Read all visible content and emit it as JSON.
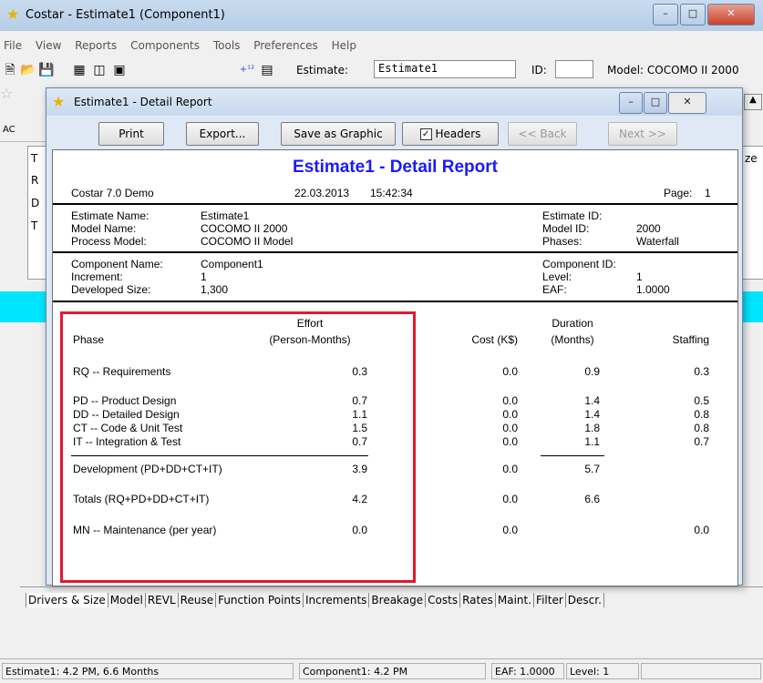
{
  "app": {
    "title": "Costar - Estimate1 (Component1)",
    "menu": [
      "File",
      "View",
      "Reports",
      "Components",
      "Tools",
      "Preferences",
      "Help"
    ],
    "estimate_label": "Estimate:",
    "estimate_value": "Estimate1",
    "id_label": "ID:",
    "id_value": "",
    "model_label": "Model: COCOMO II 2000",
    "bg_left_labels": [
      "AC",
      "T",
      "R",
      "D",
      "T"
    ],
    "bg_right_label": "ze"
  },
  "dialog": {
    "title": "Estimate1 - Detail Report",
    "buttons": {
      "print": "Print",
      "export": "Export...",
      "save_graphic": "Save as Graphic",
      "headers": "Headers",
      "back": "<< Back",
      "next": "Next >>"
    },
    "headers_checked": true
  },
  "report": {
    "title": "Estimate1 - Detail Report",
    "product": "Costar 7.0 Demo",
    "date": "22.03.2013",
    "time": "15:42:34",
    "page_label": "Page:",
    "page": "1",
    "estimate": {
      "name_label": "Estimate Name:",
      "name": "Estimate1",
      "model_label": "Model Name:",
      "model": "COCOMO II 2000",
      "process_label": "Process Model:",
      "process": "COCOMO II Model",
      "id_label": "Estimate ID:",
      "id": "",
      "model_id_label": "Model ID:",
      "model_id": "2000",
      "phases_label": "Phases:",
      "phases": "Waterfall"
    },
    "component": {
      "name_label": "Component Name:",
      "name": "Component1",
      "increment_label": "Increment:",
      "increment": "1",
      "size_label": "Developed Size:",
      "size": "1,300",
      "id_label": "Component ID:",
      "id": "",
      "level_label": "Level:",
      "level": "1",
      "eaf_label": "EAF:",
      "eaf": "1.0000"
    },
    "columns": {
      "phase": "Phase",
      "effort_1": "Effort",
      "effort_2": "(Person-Months)",
      "cost": "Cost (K$)",
      "duration_1": "Duration",
      "duration_2": "(Months)",
      "staffing": "Staffing"
    },
    "rows": [
      {
        "phase": "RQ -- Requirements",
        "effort": "0.3",
        "cost": "0.0",
        "duration": "0.9",
        "staffing": "0.3"
      },
      {
        "phase": "PD -- Product Design",
        "effort": "0.7",
        "cost": "0.0",
        "duration": "1.4",
        "staffing": "0.5"
      },
      {
        "phase": "DD -- Detailed Design",
        "effort": "1.1",
        "cost": "0.0",
        "duration": "1.4",
        "staffing": "0.8"
      },
      {
        "phase": "CT -- Code & Unit Test",
        "effort": "1.5",
        "cost": "0.0",
        "duration": "1.8",
        "staffing": "0.8"
      },
      {
        "phase": "IT -- Integration & Test",
        "effort": "0.7",
        "cost": "0.0",
        "duration": "1.1",
        "staffing": "0.7"
      },
      {
        "phase": "Development (PD+DD+CT+IT)",
        "effort": "3.9",
        "cost": "0.0",
        "duration": "5.7",
        "staffing": ""
      },
      {
        "phase": "Totals (RQ+PD+DD+CT+IT)",
        "effort": "4.2",
        "cost": "0.0",
        "duration": "6.6",
        "staffing": ""
      },
      {
        "phase": "MN -- Maintenance (per year)",
        "effort": "0.0",
        "cost": "0.0",
        "duration": "",
        "staffing": "0.0"
      }
    ]
  },
  "tabs": [
    "Drivers & Size",
    "Model",
    "REVL",
    "Reuse",
    "Function Points",
    "Increments",
    "Breakage",
    "Costs",
    "Rates",
    "Maint.",
    "Filter",
    "Descr."
  ],
  "status": {
    "left": "Estimate1:  4.2 PM,  6.6 Months",
    "middle": "Component1:  4.2 PM",
    "eaf": "EAF: 1.0000",
    "level": "Level:  1"
  },
  "colors": {
    "report_title": "#1a1aff",
    "highlight": "#e01a2d",
    "cyan_band": "#00e5ff"
  }
}
